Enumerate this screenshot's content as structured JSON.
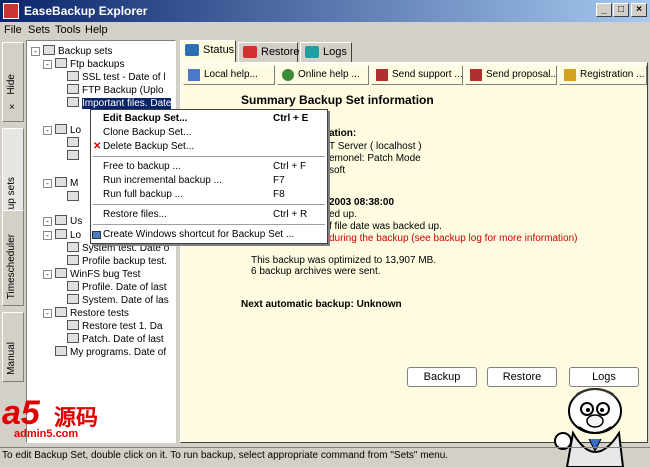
{
  "window": {
    "title": "EaseBackup Explorer",
    "minimize_glyph": "_",
    "maximize_glyph": "□",
    "close_glyph": "×"
  },
  "menu": [
    "File",
    "Sets",
    "Tools",
    "Help"
  ],
  "side_tabs": {
    "hide": "Hide",
    "hide_glyph": "×",
    "backup_sets": "Backup sets",
    "timescheduler": "Timescheduler",
    "manual": "Manual"
  },
  "tree": {
    "root": "Backup sets",
    "items": [
      "Ftp backups",
      "SSL test - Date of l",
      "FTP Backup (Uplo",
      "Important files. Date",
      "Lo",
      "M",
      "Us",
      "Lo",
      "System test. Date o",
      "Profile backup test.",
      "WinFS bug Test",
      "Profile. Date of last",
      "System. Date of las",
      "Restore tests",
      "Restore test 1. Da",
      "Patch. Date of last",
      "My programs. Date of"
    ]
  },
  "tabs": [
    "Status",
    "Restore",
    "Logs"
  ],
  "toolbar": [
    "Local help...",
    "Online help ...",
    "Send support ...",
    "Send proposal...",
    "Registration ..."
  ],
  "summary": {
    "title": "Summary Backup Set information",
    "lines": [
      "ation:",
      "T Server ( localhost )",
      "emonel: Patch Mode",
      "soft",
      "2003 08:38:00",
      "ed up.",
      "f file date was backed up.",
      "during the backup (see backup log for more information)",
      "This backup was optimized to 13,907 MB.",
      "6 backup archives were sent.",
      "Next automatic backup: Unknown"
    ]
  },
  "buttons": {
    "backup": "Backup",
    "restore": "Restore",
    "logs": "Logs"
  },
  "context_menu": {
    "items": [
      {
        "label": "Edit Backup Set...",
        "shortcut": "Ctrl + E"
      },
      {
        "label": "Clone Backup Set...",
        "shortcut": ""
      },
      {
        "label": "Delete Backup Set...",
        "shortcut": ""
      },
      {
        "label": "Free to backup ...",
        "shortcut": "Ctrl + F"
      },
      {
        "label": "Run incremental backup ...",
        "shortcut": "F7"
      },
      {
        "label": "Run full backup ...",
        "shortcut": "F8"
      },
      {
        "label": "Restore files...",
        "shortcut": "Ctrl + R"
      },
      {
        "label": "Create Windows shortcut for Backup Set ...",
        "shortcut": ""
      }
    ]
  },
  "status_bar": "To edit Backup Set, double click on it. To run backup, select appropriate command from \"Sets\" menu.",
  "watermark": {
    "brand": "a5",
    "cn": "源码",
    "site": "admin5.com"
  },
  "colors": {
    "title_start": "#0a246a",
    "content_bg": "#fffbe0",
    "warning_text": "#cc0000",
    "watermark": "#e00000"
  }
}
